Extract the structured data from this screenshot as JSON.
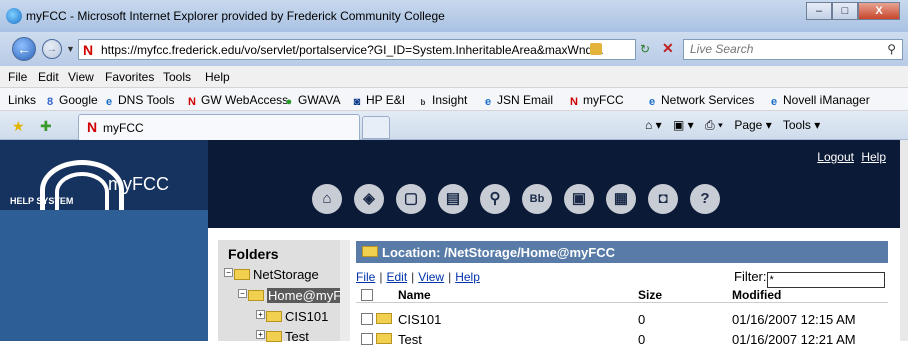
{
  "window": {
    "title": "myFCC - Microsoft Internet Explorer provided by Frederick Community College",
    "buttons": [
      "–",
      "□",
      "X"
    ]
  },
  "address_bar": {
    "url": "https://myfcc.frederick.edu/vo/servlet/portalservice?GI_ID=System.InheritableArea&maxWnd=\\",
    "search_placeholder": "Live Search"
  },
  "menu": [
    "File",
    "Edit",
    "View",
    "Favorites",
    "Tools",
    "Help"
  ],
  "links_bar": {
    "label": "Links",
    "items": [
      "Google",
      "DNS Tools",
      "GW WebAccess",
      "GWAVA",
      "HP E&I",
      "Insight",
      "JSN Email",
      "myFCC",
      "Network Services",
      "Novell iManager"
    ]
  },
  "tab": {
    "label": "myFCC"
  },
  "command_bar": [
    "Page ▾",
    "Tools ▾"
  ],
  "page": {
    "logo_text": "myFCC",
    "help_system": "HELP SYSTEM",
    "logout": "Logout",
    "help": "Help",
    "nav_icons": [
      "home-icon",
      "compass-icon",
      "document-icon",
      "printer-icon",
      "search-icon",
      "bb-icon",
      "inbox-icon",
      "calendar-icon",
      "lock-icon",
      "help-icon"
    ]
  },
  "folders": {
    "title": "Folders",
    "tree": [
      {
        "label": "NetStorage",
        "level": 0
      },
      {
        "label": "Home@myF",
        "level": 1,
        "selected": true
      },
      {
        "label": "CIS101",
        "level": 2
      },
      {
        "label": "Test",
        "level": 2
      }
    ]
  },
  "listing": {
    "location": "Location: /NetStorage/Home@myFCC",
    "menu": [
      "File",
      "Edit",
      "View",
      "Help"
    ],
    "filter_label": "Filter:",
    "filter_value": "*",
    "columns": [
      "Name",
      "Size",
      "Modified"
    ],
    "rows": [
      {
        "name": "CIS101",
        "size": "0",
        "modified": "01/16/2007 12:15 AM"
      },
      {
        "name": "Test",
        "size": "0",
        "modified": "01/16/2007 12:21 AM"
      }
    ]
  }
}
